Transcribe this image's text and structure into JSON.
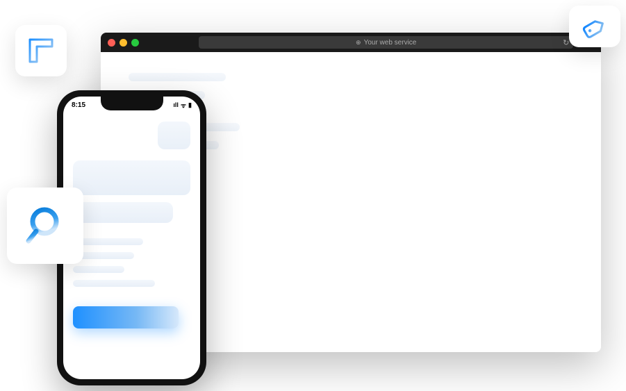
{
  "browser": {
    "address_text": "Your web service"
  },
  "phone": {
    "time": "8:15",
    "signal": "ıll",
    "wifi": "ᯤ",
    "battery": "▮"
  },
  "icons": {
    "ruler": "ruler-icon",
    "search": "search-icon",
    "tag": "tag-icon"
  }
}
